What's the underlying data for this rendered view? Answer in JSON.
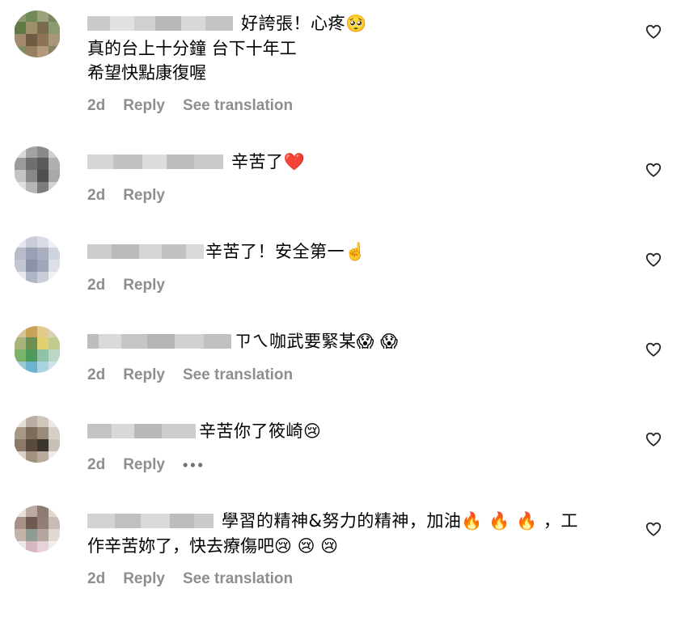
{
  "labels": {
    "reply": "Reply",
    "see_translation": "See translation"
  },
  "comments": [
    {
      "text": "好誇張！心疼🥺",
      "text2": "真的台上十分鐘 台下十年工",
      "text3": "希望快點康復喔",
      "age": "2d",
      "has_translation": true
    },
    {
      "text": "辛苦了❤️",
      "age": "2d",
      "has_translation": false
    },
    {
      "text": "辛苦了！安全第一☝️",
      "age": "2d",
      "has_translation": false
    },
    {
      "text": "ㄗㄟ咖武要緊某😱 😱",
      "age": "2d",
      "has_translation": true
    },
    {
      "text": "辛苦你了筱崎😢",
      "age": "2d",
      "has_translation": false,
      "more": "•••"
    },
    {
      "text": "學習的精神&努力的精神，加油🔥 🔥 🔥 ，工",
      "text2": "作辛苦妳了，快去療傷吧😢 😢 😢",
      "age": "2d",
      "has_translation": true
    }
  ],
  "colors": {
    "muted": "#8e8e8e",
    "icon": "#262626"
  }
}
